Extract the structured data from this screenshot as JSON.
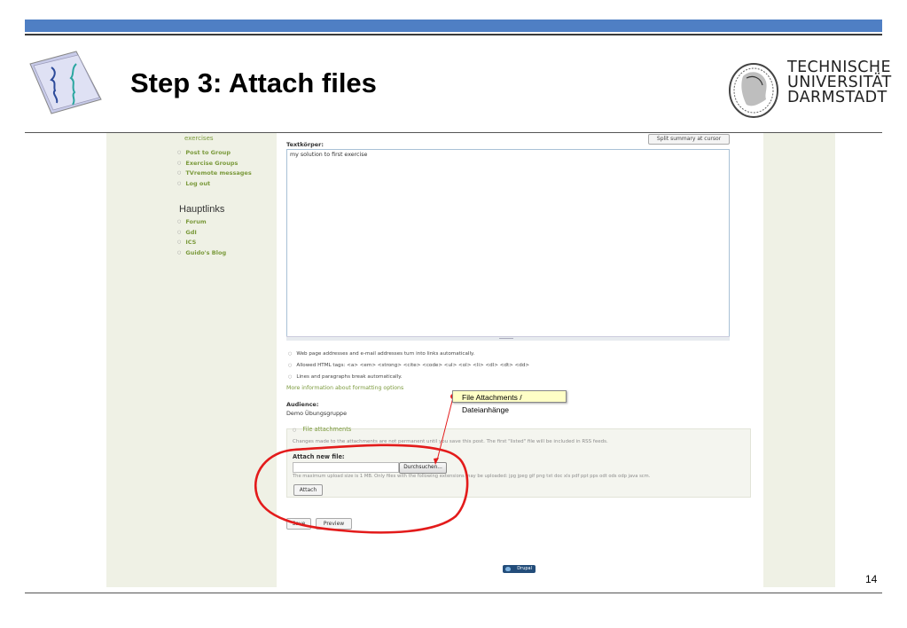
{
  "slide": {
    "title": "Step 3: Attach files",
    "university_lines": [
      "TECHNISCHE",
      "UNIVERSITÄT",
      "DARMSTADT"
    ],
    "page_number": "14"
  },
  "sidebar": {
    "top_item": "exercises",
    "items": [
      "Post to Group",
      "Exercise Groups",
      "TVremote messages",
      "Log out"
    ],
    "section_heading": "Hauptlinks",
    "links": [
      "Forum",
      "GdI",
      "ICS",
      "Guido's Blog"
    ]
  },
  "form": {
    "split_button": "Split summary at cursor",
    "body_label": "Textkörper:",
    "body_value": "my solution to first exercise",
    "format_tips": [
      "Web page addresses and e-mail addresses turn into links automatically.",
      "Allowed HTML tags: <a> <em> <strong> <cite> <code> <ul> <ol> <li> <dl> <dt> <dd>",
      "Lines and paragraphs break automatically."
    ],
    "more_info_link": "More information about formatting options",
    "audience_label": "Audience:",
    "audience_value": "Demo Übungsgruppe",
    "attachments": {
      "legend": "File attachments",
      "description": "Changes made to the attachments are not permanent until you save this post. The first \"listed\" file will be included in RSS feeds.",
      "new_file_label": "Attach new file:",
      "browse_button": "Durchsuchen...",
      "note": "The maximum upload size is 1 MB. Only files with the following extensions may be uploaded: jpg jpeg gif png txt doc xls pdf ppt pps odt ods odp java scm.",
      "attach_button": "Attach"
    },
    "save_button": "Save",
    "preview_button": "Preview",
    "footer_badge": "Drupal"
  },
  "annotation": {
    "callout_text": "File Attachments / Dateianhänge",
    "highlight_color": "#e31b1b"
  }
}
